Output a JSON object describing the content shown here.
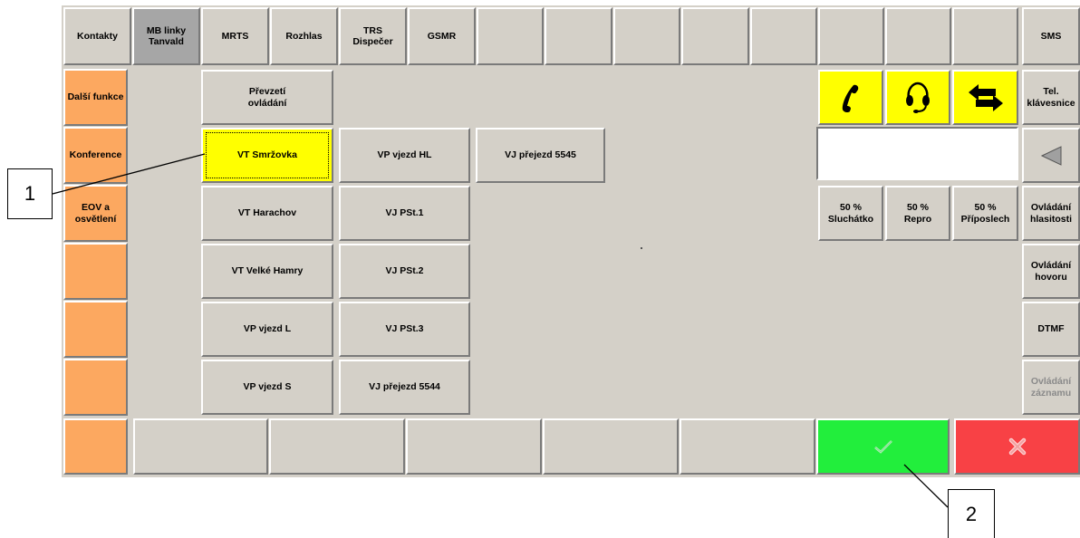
{
  "top_row": {
    "kontakty": "Kontakty",
    "mb_linky": "MB linky\nTanvald",
    "mrts": "MRTS",
    "rozhlas": "Rozhlas",
    "trs": "TRS\nDispečer",
    "gsmr": "GSMR",
    "sms": "SMS"
  },
  "left_column": {
    "dalsi_funkce": "Další funkce",
    "konference": "Konference",
    "eov": "EOV a\nosvětlení"
  },
  "main": {
    "prevzeti": "Převzetí\novládání",
    "vt_smrzovka": "VT Smržovka",
    "vp_vjezd_hl": "VP vjezd HL",
    "vj_prejezd_5545": "VJ přejezd 5545",
    "vt_harachov": "VT Harachov",
    "vj_pst1": "VJ PSt.1",
    "vt_velke_hamry": "VT Velké Hamry",
    "vj_pst2": "VJ PSt.2",
    "vp_vjezd_l": "VP vjezd L",
    "vj_pst3": "VJ PSt.3",
    "vp_vjezd_s": "VP vjezd S",
    "vj_prejezd_5544": "VJ přejezd 5544"
  },
  "right_panel": {
    "tel_klavesnice": "Tel.\nklávesnice",
    "vol_sluchatko": "50 %\nSluchátko",
    "vol_repro": "50 %\nRepro",
    "vol_priposlech": "50 %\nPříposlech",
    "ovladani_hlasitosti": "Ovládání\nhlasitosti",
    "ovladani_hovoru": "Ovládání\nhovoru",
    "dtmf": "DTMF",
    "ovladani_zaznamu": "Ovládání\nzáznamu",
    "display_value": ""
  },
  "callouts": {
    "one": "1",
    "two": "2"
  },
  "colors": {
    "panel": "#d4d0c8",
    "orange": "#fca860",
    "yellow": "#ffff00",
    "green": "#22ee3c",
    "red": "#f84145"
  },
  "icons": {
    "phone": "phone-handset-icon",
    "headset": "headset-icon",
    "transfer": "transfer-arrows-icon",
    "backspace": "backspace-triangle-icon",
    "confirm": "checkmark-icon",
    "cancel": "cross-icon"
  }
}
